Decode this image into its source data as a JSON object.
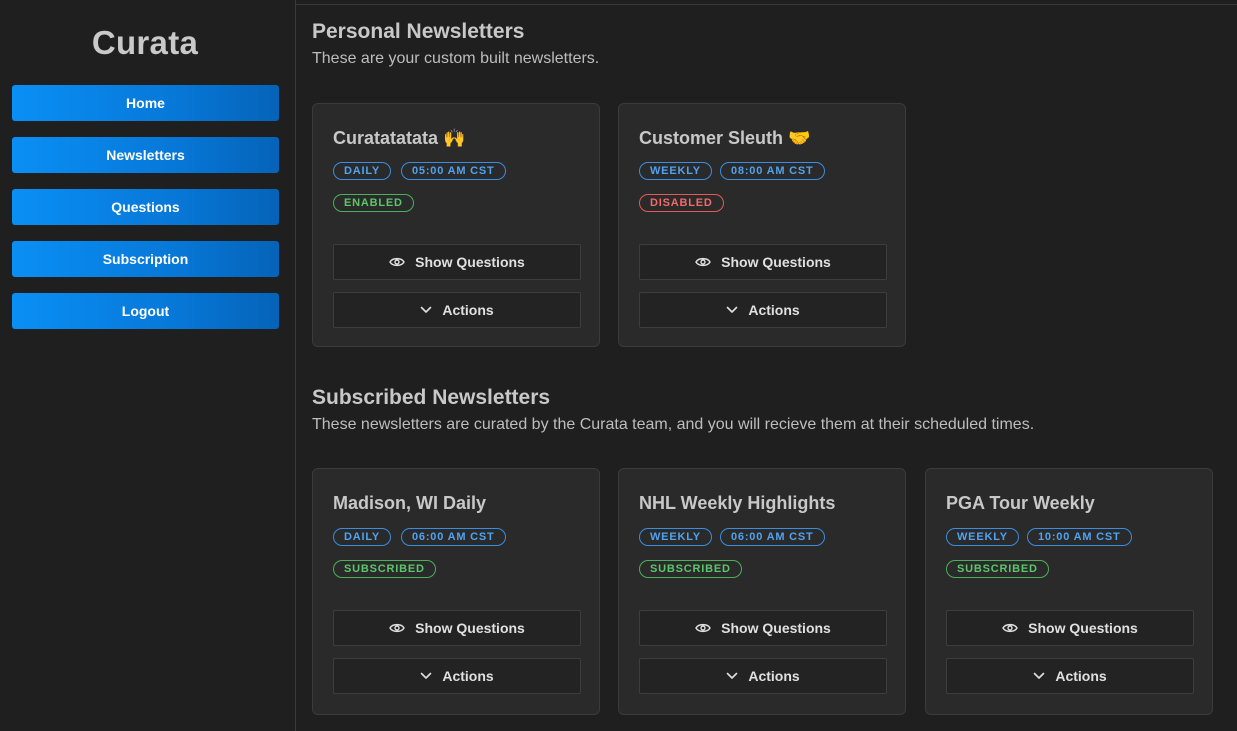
{
  "sidebar": {
    "brand": "Curata",
    "nav": [
      {
        "label": "Home"
      },
      {
        "label": "Newsletters"
      },
      {
        "label": "Questions"
      },
      {
        "label": "Subscription"
      },
      {
        "label": "Logout"
      }
    ]
  },
  "personal": {
    "title": "Personal Newsletters",
    "subtitle": "These are your custom built newsletters.",
    "cards": [
      {
        "title": "Curatatatata 🙌",
        "frequency": "DAILY",
        "time": "05:00 AM CST",
        "status": "ENABLED",
        "status_color": "#5cc66a",
        "show_label": "Show Questions",
        "actions_label": "Actions"
      },
      {
        "title": "Customer Sleuth 🤝",
        "frequency": "WEEKLY",
        "time": "08:00 AM CST",
        "status": "DISABLED",
        "status_color": "#f06a6a",
        "show_label": "Show Questions",
        "actions_label": "Actions"
      }
    ]
  },
  "subscribed": {
    "title": "Subscribed Newsletters",
    "subtitle": "These newsletters are curated by the Curata team, and you will recieve them at their scheduled times.",
    "cards": [
      {
        "title": "Madison, WI Daily",
        "frequency": "DAILY",
        "time": "06:00 AM CST",
        "status": "SUBSCRIBED",
        "status_color": "#5cc66a",
        "show_label": "Show Questions",
        "actions_label": "Actions"
      },
      {
        "title": "NHL Weekly Highlights",
        "frequency": "WEEKLY",
        "time": "06:00 AM CST",
        "status": "SUBSCRIBED",
        "status_color": "#5cc66a",
        "show_label": "Show Questions",
        "actions_label": "Actions"
      },
      {
        "title": "PGA Tour Weekly",
        "frequency": "WEEKLY",
        "time": "10:00 AM CST",
        "status": "SUBSCRIBED",
        "status_color": "#5cc66a",
        "show_label": "Show Questions",
        "actions_label": "Actions"
      }
    ]
  },
  "icons": {
    "show": "eye-icon",
    "actions": "chevron-down-icon"
  },
  "colors": {
    "accent": "#0a8ff5",
    "background": "#1f1f1f",
    "card": "#2a2a2a"
  }
}
